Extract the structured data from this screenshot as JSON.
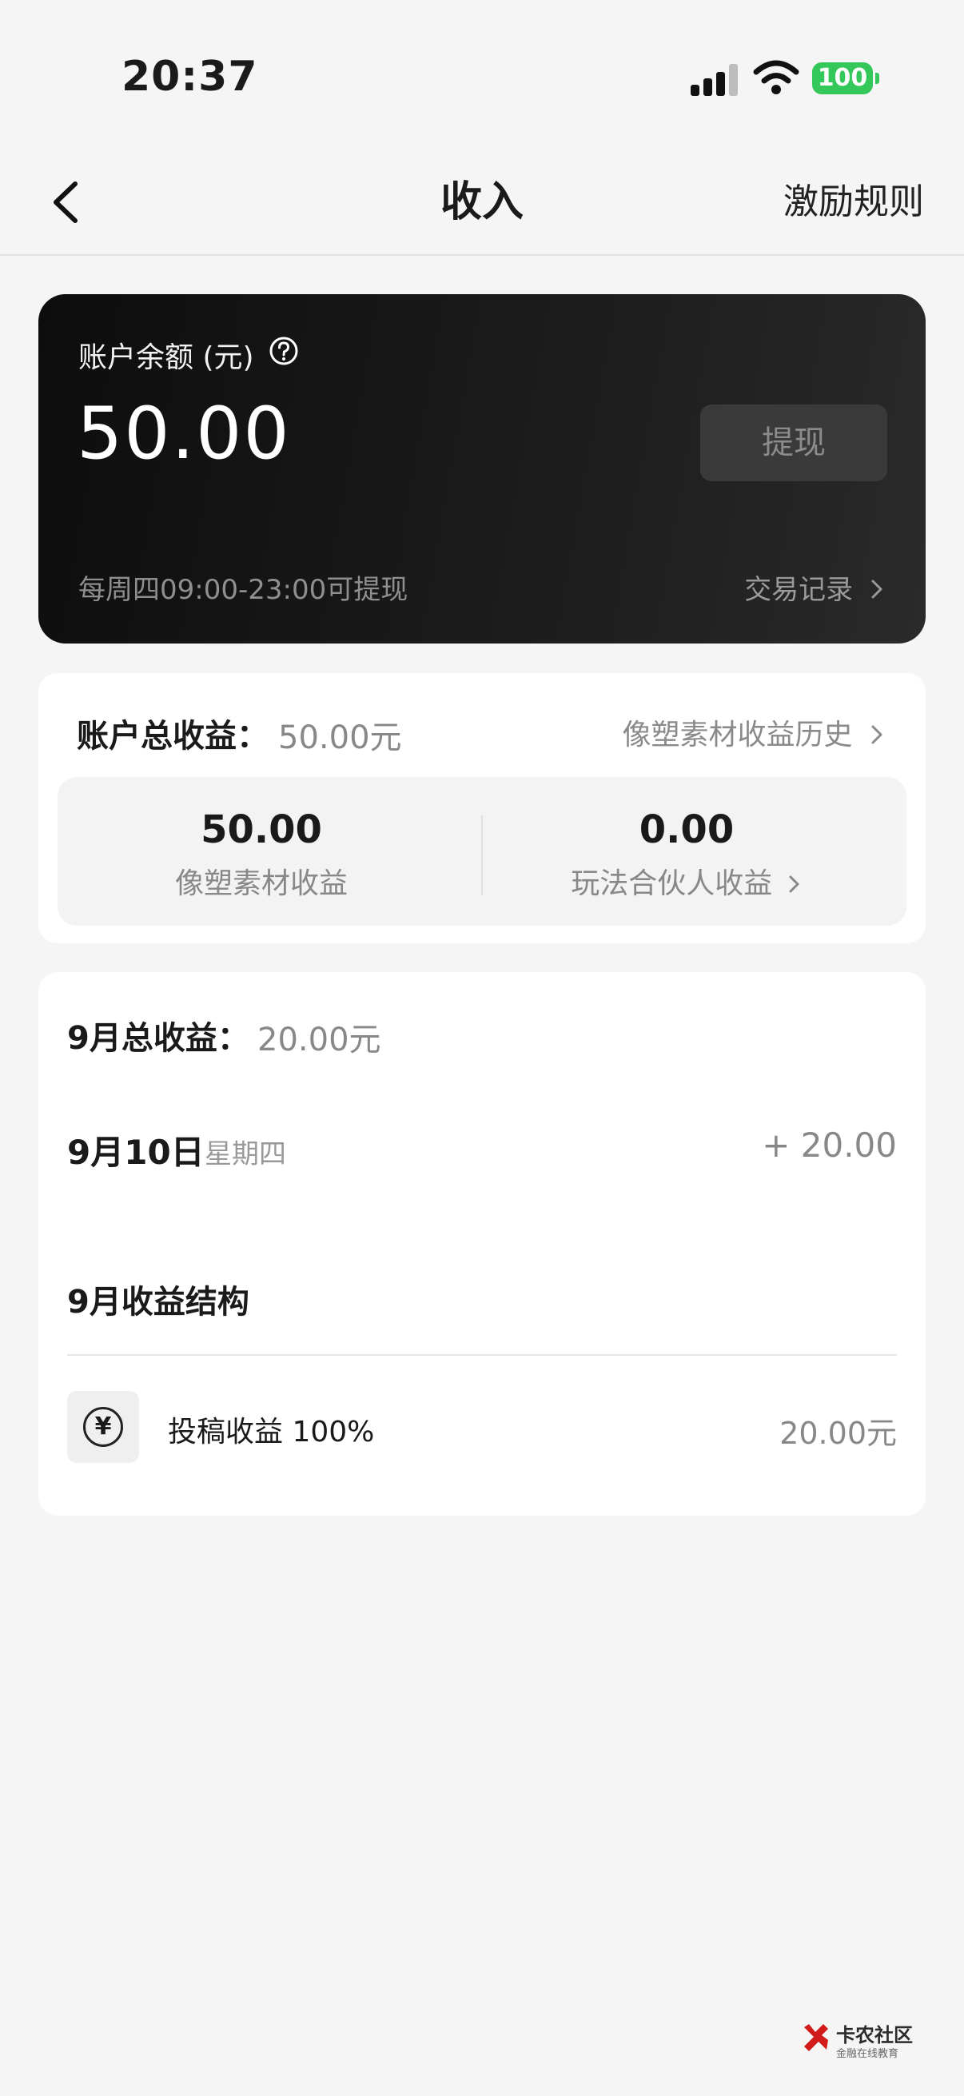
{
  "status_bar": {
    "time": "20:37",
    "battery": "100"
  },
  "nav": {
    "title": "收入",
    "right_link": "激励规则"
  },
  "balance_card": {
    "label": "账户余额 (元)",
    "amount": "50.00",
    "withdraw_button": "提现",
    "hint": "每周四09:00-23:00可提现",
    "records_link": "交易记录"
  },
  "earnings_card": {
    "total_label": "账户总收益：",
    "total_value": "50.00元",
    "history_link": "像塑素材收益历史",
    "items": [
      {
        "value": "50.00",
        "label": "像塑素材收益"
      },
      {
        "value": "0.00",
        "label": "玩法合伙人收益"
      }
    ]
  },
  "month_card": {
    "total_label": "9月总收益：",
    "total_value": "20.00元",
    "day": {
      "date": "9月10日",
      "weekday": "星期四",
      "amount": "+ 20.00"
    },
    "structure_title": "9月收益结构",
    "structure_items": [
      {
        "icon": "yen-icon",
        "label": "投稿收益 100%",
        "value": "20.00元"
      }
    ]
  },
  "watermark": {
    "title": "卡农社区",
    "subtitle": "金融在线教育"
  }
}
